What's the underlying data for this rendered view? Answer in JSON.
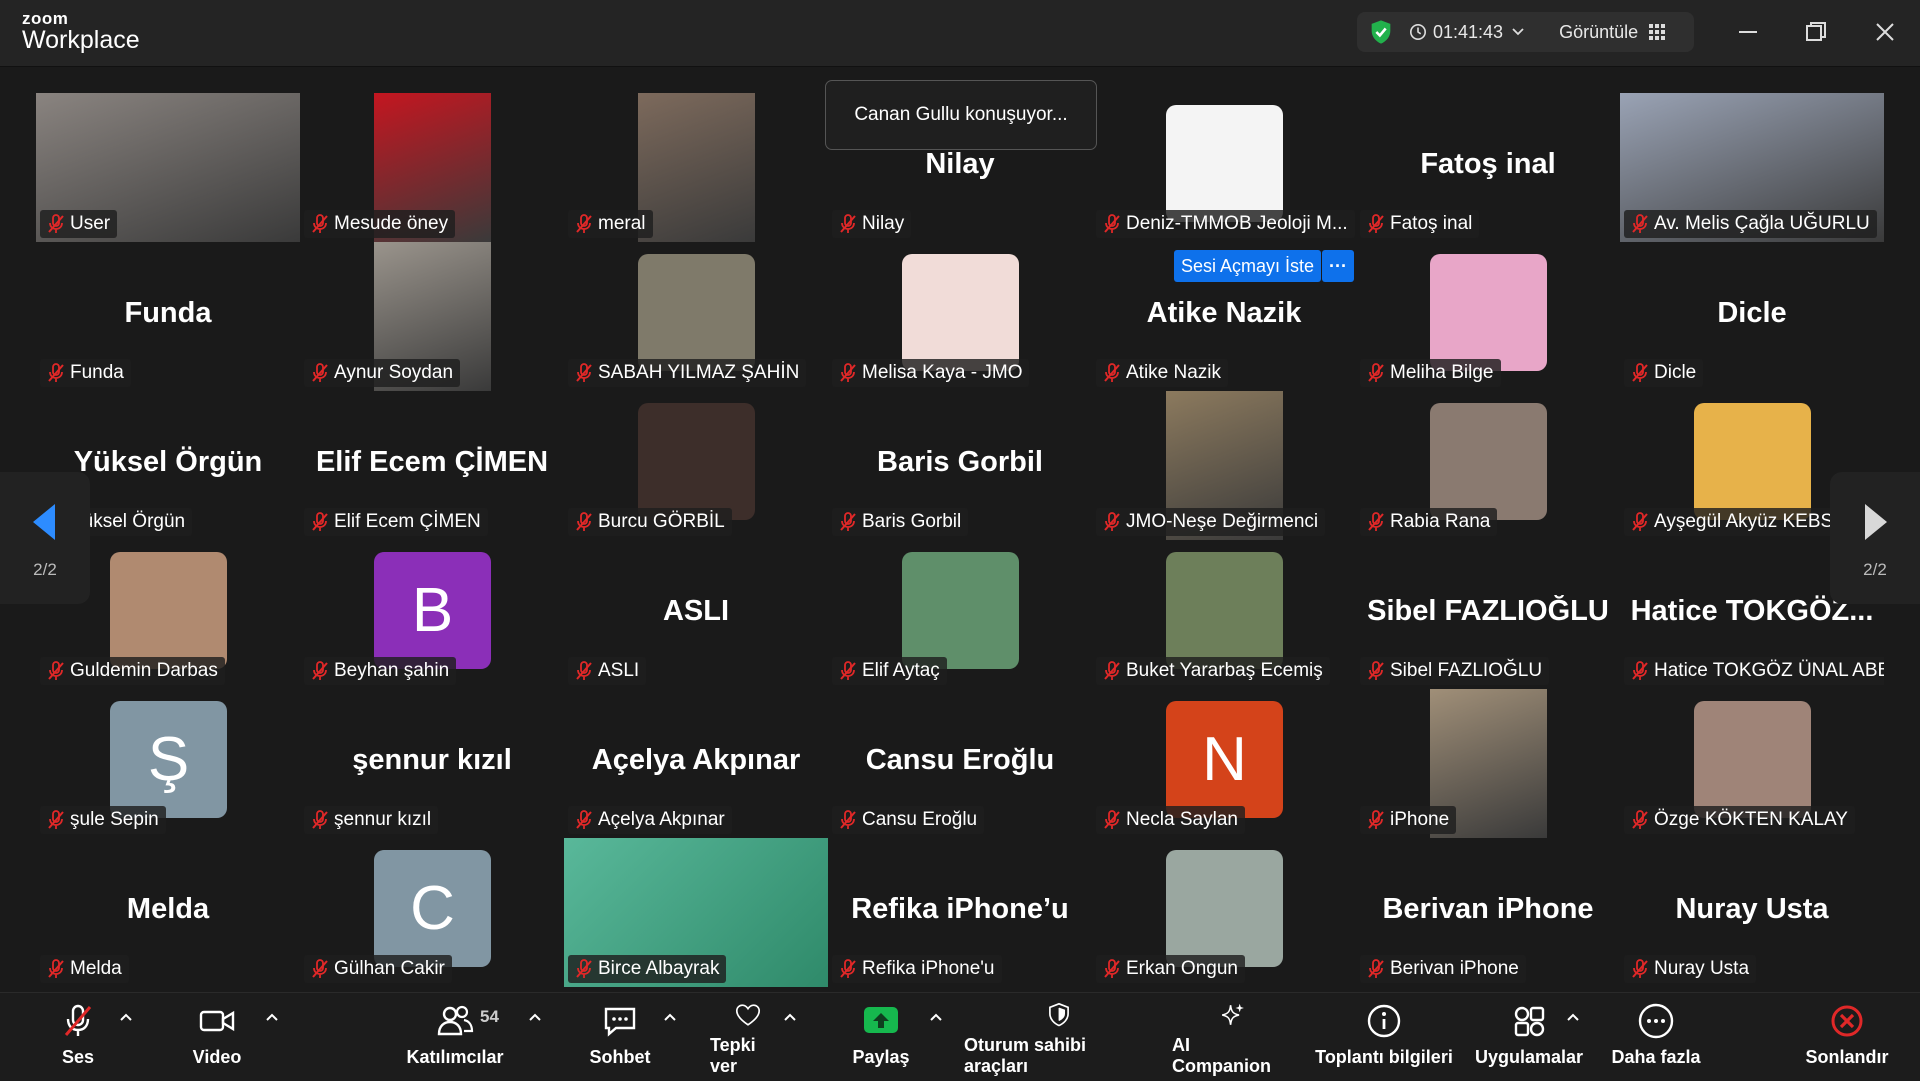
{
  "app": {
    "logo_top": "zoom",
    "logo_product": "Workplace",
    "timer": "01:41:43",
    "view_label": "Görüntüle",
    "colors": {
      "accent": "#0e71eb",
      "shield": "#22b14c",
      "mute_red": "#e02828",
      "end_red": "#e02828",
      "share_green": "#16b84e"
    }
  },
  "overlay": {
    "speaking": "Canan Gullu konuşuyor...",
    "ask_unmute": "Sesi Açmayı İste",
    "ask_more": "···"
  },
  "pager": {
    "left": "2/2",
    "right": "2/2"
  },
  "tiles": [
    {
      "label": "User",
      "type": "video",
      "color": "#8a8480"
    },
    {
      "label": "Mesude öney",
      "type": "video",
      "color": "#c41620"
    },
    {
      "label": "meral",
      "type": "video",
      "color": "#7d6a5c"
    },
    {
      "label": "Nilay",
      "type": "name",
      "big": "Nilay"
    },
    {
      "label": "Deniz-TMMOB Jeoloji M...",
      "type": "avatar",
      "color": "#f4f4f4",
      "avatar_text": ""
    },
    {
      "label": "Fatoş inal",
      "type": "name",
      "big": "Fatoş inal"
    },
    {
      "label": "Av. Melis Çağla UĞURLU",
      "type": "video",
      "color": "#9aa3b5"
    },
    {
      "label": "Funda",
      "type": "name",
      "big": "Funda"
    },
    {
      "label": "Aynur Soydan",
      "type": "video",
      "color": "#9a948c"
    },
    {
      "label": "SABAH YILMAZ ŞAHİN",
      "type": "avatar",
      "color": "#7f7a6a",
      "avatar_text": ""
    },
    {
      "label": "Melisa Kaya - JMO",
      "type": "avatar",
      "color": "#f1dcd8",
      "avatar_text": ""
    },
    {
      "label": "Atike Nazik",
      "type": "name",
      "big": "Atike Nazik"
    },
    {
      "label": "Meliha Bilge",
      "type": "avatar",
      "color": "#e8a6c8",
      "avatar_text": ""
    },
    {
      "label": "Dicle",
      "type": "name",
      "big": "Dicle"
    },
    {
      "label": "Yüksel Örgün",
      "type": "name",
      "big": "Yüksel Örgün"
    },
    {
      "label": "Elif  Ecem ÇİMEN",
      "type": "name",
      "big": "Elif  Ecem ÇİMEN"
    },
    {
      "label": "Burcu GÖRBİL",
      "type": "avatar",
      "color": "#3d2e2a",
      "avatar_text": ""
    },
    {
      "label": "Baris Gorbil",
      "type": "name",
      "big": "Baris Gorbil"
    },
    {
      "label": "JMO-Neşe Değirmenci",
      "type": "video",
      "color": "#8c7a5e"
    },
    {
      "label": "Rabia Rana",
      "type": "avatar",
      "color": "#8a7a70",
      "avatar_text": ""
    },
    {
      "label": "Ayşegül Akyüz KEBSE",
      "type": "avatar",
      "color": "#e7b24a",
      "avatar_text": ""
    },
    {
      "label": "Guldemin Darbas",
      "type": "avatar",
      "color": "#b08a70",
      "avatar_text": ""
    },
    {
      "label": "Beyhan şahin",
      "type": "avatar",
      "color": "#8b2fb8",
      "avatar_text": "B"
    },
    {
      "label": "ASLI",
      "type": "name",
      "big": "ASLI"
    },
    {
      "label": "Elif Aytaç",
      "type": "avatar",
      "color": "#5f8f6a",
      "avatar_text": ""
    },
    {
      "label": "Buket Yararbaş Ecemiş",
      "type": "avatar",
      "color": "#6d7f5a",
      "avatar_text": ""
    },
    {
      "label": "Sibel FAZLIOĞLU",
      "type": "name",
      "big": "Sibel FAZLIOĞLU"
    },
    {
      "label": "Hatice TOKGÖZ ÜNAL ABB",
      "type": "name",
      "big": "Hatice  TOKGÖZ..."
    },
    {
      "label": "şule Sepin",
      "type": "avatar",
      "color": "#8196a3",
      "avatar_text": "Ş"
    },
    {
      "label": "şennur kızıl",
      "type": "name",
      "big": "şennur kızıl"
    },
    {
      "label": "Açelya Akpınar",
      "type": "name",
      "big": "Açelya Akpınar"
    },
    {
      "label": "Cansu Eroğlu",
      "type": "name",
      "big": "Cansu Eroğlu"
    },
    {
      "label": "Necla Saylan",
      "type": "avatar",
      "color": "#d4431a",
      "avatar_text": "N"
    },
    {
      "label": "iPhone",
      "type": "video",
      "color": "#a08f78"
    },
    {
      "label": "Özge KÖKTEN KALAY",
      "type": "avatar",
      "color": "#9f8478",
      "avatar_text": ""
    },
    {
      "label": "Melda",
      "type": "name",
      "big": "Melda"
    },
    {
      "label": "Gülhan Cakir",
      "type": "avatar",
      "color": "#8196a3",
      "avatar_text": "C"
    },
    {
      "label": "Birce Albayrak",
      "type": "fullvideo",
      "color": "#59b89a"
    },
    {
      "label": "Refika iPhone'u",
      "type": "name",
      "big": "Refika iPhone’u"
    },
    {
      "label": "Erkan Ongun",
      "type": "avatar",
      "color": "#9aa7a0",
      "avatar_text": ""
    },
    {
      "label": "Berivan iPhone",
      "type": "name",
      "big": "Berivan iPhone"
    },
    {
      "label": "Nuray Usta",
      "type": "name",
      "big": "Nuray Usta"
    }
  ],
  "toolbar": {
    "audio": "Ses",
    "video": "Video",
    "participants": "Katılımcılar",
    "participants_count": "54",
    "chat": "Sohbet",
    "react": "Tepki ver",
    "share": "Paylaş",
    "host_tools": "Oturum sahibi araçları",
    "ai_companion": "AI Companion",
    "meeting_info": "Toplantı bilgileri",
    "apps": "Uygulamalar",
    "more": "Daha fazla",
    "end": "Sonlandır"
  }
}
